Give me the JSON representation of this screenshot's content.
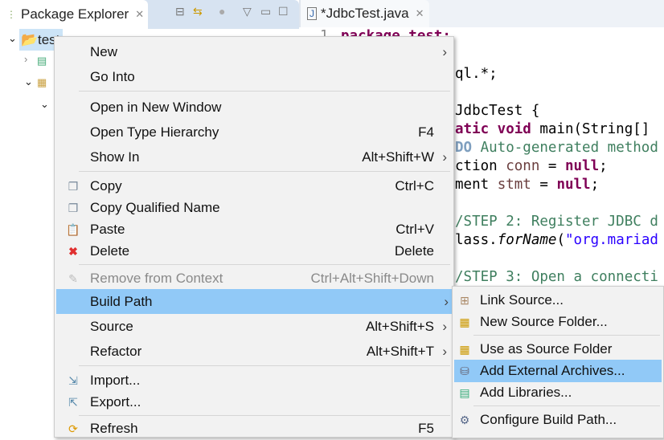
{
  "package_explorer": {
    "title": "Package Explorer",
    "project": "test"
  },
  "editor": {
    "tab_title": "*JdbcTest.java",
    "line1_number": "1",
    "line1": "package test;",
    "code": {
      "l3": "ql.*;",
      "l5": "JdbcTest {",
      "l6_kw": "atic void",
      "l6_rest": " main(String[]",
      "l7_todo": "DO",
      "l7_rest": " Auto-generated method",
      "l8_a": "ction ",
      "l8_var": "conn",
      "l8_b": " = ",
      "l8_kw": "null",
      "l8_c": ";",
      "l9_a": "ment ",
      "l9_var": "stmt",
      "l9_b": " = ",
      "l9_kw": "null",
      "l9_c": ";",
      "l11": "/STEP 2: Register JDBC d",
      "l12_a": "lass.",
      "l12_it": "forName",
      "l12_b": "(",
      "l12_str": "\"org.mariad",
      "l14": "/STEP 3: Open a connecti"
    }
  },
  "context_menu": {
    "items": [
      {
        "label": "New",
        "shortcut": "",
        "submenu": true
      },
      {
        "label": "Go Into",
        "shortcut": ""
      },
      {
        "label": "Open in New Window",
        "shortcut": ""
      },
      {
        "label": "Open Type Hierarchy",
        "shortcut": "F4"
      },
      {
        "label": "Show In",
        "shortcut": "Alt+Shift+W",
        "submenu": true
      },
      {
        "label": "Copy",
        "shortcut": "Ctrl+C",
        "icon": "copy-icon"
      },
      {
        "label": "Copy Qualified Name",
        "shortcut": "",
        "icon": "copy-qualified-name-icon"
      },
      {
        "label": "Paste",
        "shortcut": "Ctrl+V",
        "icon": "paste-icon"
      },
      {
        "label": "Delete",
        "shortcut": "Delete",
        "icon": "delete-icon"
      },
      {
        "label": "Remove from Context",
        "shortcut": "Ctrl+Alt+Shift+Down",
        "disabled": true
      },
      {
        "label": "Build Path",
        "shortcut": "",
        "submenu": true,
        "highlighted": true
      },
      {
        "label": "Source",
        "shortcut": "Alt+Shift+S",
        "submenu": true
      },
      {
        "label": "Refactor",
        "shortcut": "Alt+Shift+T",
        "submenu": true
      },
      {
        "label": "Import...",
        "shortcut": "",
        "icon": "import-icon"
      },
      {
        "label": "Export...",
        "shortcut": "",
        "icon": "export-icon"
      },
      {
        "label": "Refresh",
        "shortcut": "F5",
        "icon": "refresh-icon"
      }
    ]
  },
  "build_path_submenu": {
    "items": [
      {
        "label": "Link Source..."
      },
      {
        "label": "New Source Folder..."
      },
      {
        "label": "Use as Source Folder"
      },
      {
        "label": "Add External Archives...",
        "highlighted": true
      },
      {
        "label": "Add Libraries..."
      },
      {
        "label": "Configure Build Path..."
      }
    ]
  },
  "colors": {
    "highlight": "#91c9f7",
    "selection": "#cce4f7",
    "keyword": "#7f0055",
    "comment": "#3f7f5f",
    "string": "#2a00ff"
  }
}
